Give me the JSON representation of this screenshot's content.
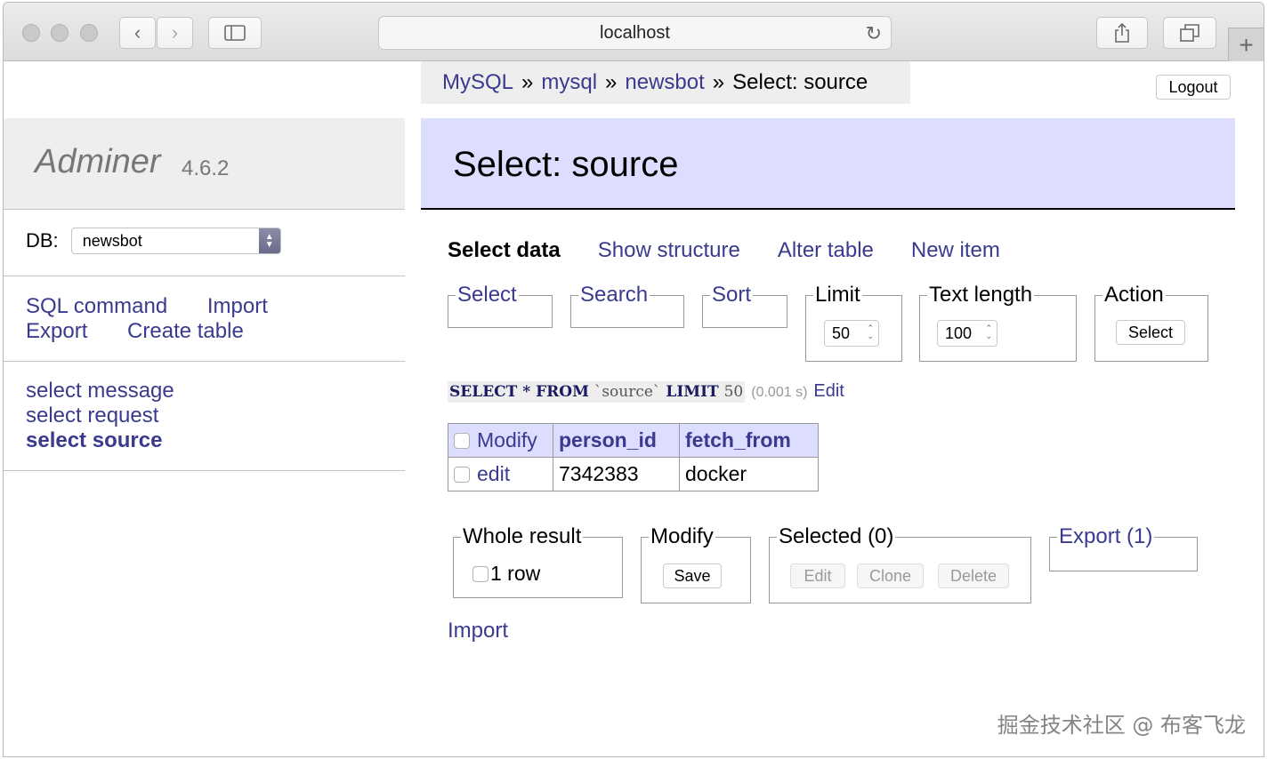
{
  "browser": {
    "url": "localhost"
  },
  "breadcrumb": {
    "items": [
      "MySQL",
      "mysql",
      "newsbot"
    ],
    "separator": "»",
    "current": "Select: source"
  },
  "logout_label": "Logout",
  "sidebar": {
    "app_name": "Adminer",
    "version": "4.6.2",
    "db_label": "DB:",
    "db_value": "newsbot",
    "links": [
      "SQL command",
      "Import",
      "Export",
      "Create table"
    ],
    "tables": [
      {
        "label": "select message",
        "active": false
      },
      {
        "label": "select request",
        "active": false
      },
      {
        "label": "select source",
        "active": true
      }
    ]
  },
  "main": {
    "title": "Select: source",
    "tabs": [
      "Select data",
      "Show structure",
      "Alter table",
      "New item"
    ],
    "fieldsets": {
      "select": "Select",
      "search": "Search",
      "sort": "Sort",
      "limit": "Limit",
      "limit_value": "50",
      "text_length": "Text length",
      "text_length_value": "100",
      "action": "Action",
      "action_button": "Select"
    },
    "sql": {
      "kw_select": "SELECT",
      "star": "*",
      "kw_from": "FROM",
      "table": "`source`",
      "kw_limit": "LIMIT",
      "limit": "50",
      "time": "(0.001 s)",
      "edit_link": "Edit"
    },
    "table": {
      "headers": [
        "Modify",
        "person_id",
        "fetch_from"
      ],
      "rows": [
        {
          "action": "edit",
          "person_id": "7342383",
          "fetch_from": "docker"
        }
      ]
    },
    "bottom": {
      "whole_result": "Whole result",
      "rows_label": "1 row",
      "modify": "Modify",
      "save": "Save",
      "selected": "Selected (0)",
      "edit": "Edit",
      "clone": "Clone",
      "delete": "Delete",
      "export": "Export (1)"
    },
    "import_link": "Import"
  },
  "watermark": "掘金技术社区 @ 布客飞龙"
}
